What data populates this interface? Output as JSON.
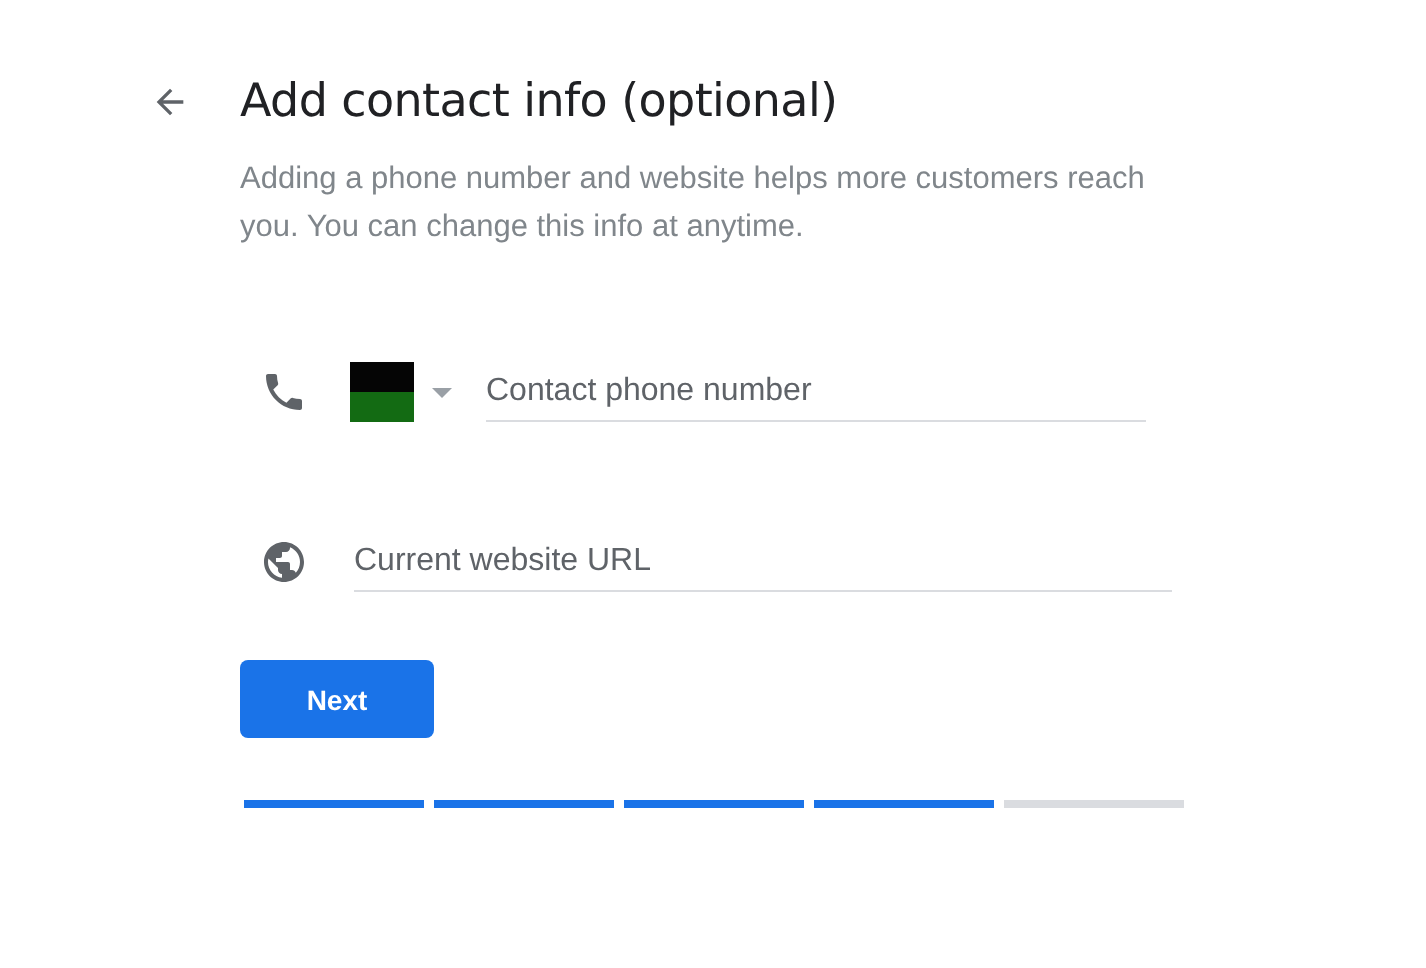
{
  "title": "Add contact info (optional)",
  "description": "Adding a phone number and website helps more customers reach you. You can change this info at anytime.",
  "phone_field": {
    "placeholder": "Contact phone number"
  },
  "website_field": {
    "placeholder": "Current website URL"
  },
  "next_button": "Next",
  "progress_steps": [
    {
      "done": true
    },
    {
      "done": true
    },
    {
      "done": true
    },
    {
      "done": true
    },
    {
      "done": false
    }
  ]
}
